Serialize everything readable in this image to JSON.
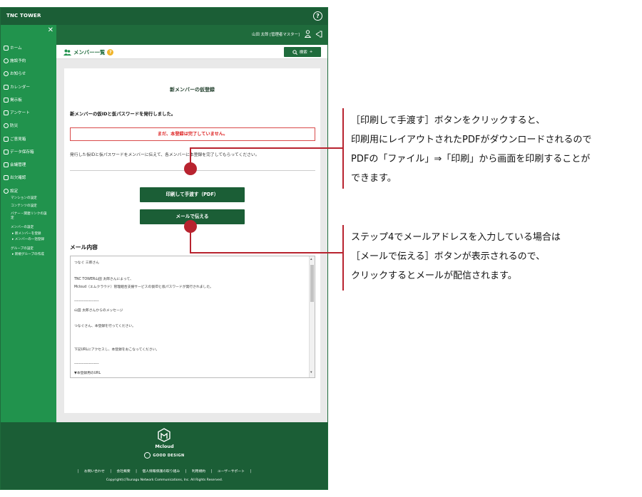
{
  "app": {
    "brand": "TNC TOWER",
    "help": "?"
  },
  "sidebar": {
    "close": "✕",
    "items": [
      {
        "label": "ホーム"
      },
      {
        "label": "施設予約"
      },
      {
        "label": "お知らせ"
      },
      {
        "label": "カレンダー"
      },
      {
        "label": "掲示板"
      },
      {
        "label": "アンケート"
      },
      {
        "label": "防災"
      },
      {
        "label": "ご意見箱"
      },
      {
        "label": "データ保存箱"
      },
      {
        "label": "会議管理"
      },
      {
        "label": "出欠確認"
      },
      {
        "label": "設定"
      }
    ],
    "settings_sub": [
      "マンションの設定",
      "コンテンツの設定",
      "バナー・関連リンクの設",
      "定",
      "メンバーの設定",
      "▸ 新メンバーを登録",
      "▸ メンバーの一括登録",
      "グループの設定",
      "▸ 新規グループの作成"
    ]
  },
  "userbar": {
    "name": "山田 太郎 [管理者マスター]"
  },
  "header": {
    "title": "メンバー一覧",
    "badge": "?",
    "search_label": "検索",
    "search_plus": "+"
  },
  "panel": {
    "title": "新メンバーの仮登録",
    "issued": "新メンバーの仮IDと仮パスワードを発行しました。",
    "warning": "まだ、本登録は完了していません。",
    "description": "発行した仮IDと仮パスワードをメンバーに伝えて、各メンバーに本登録を完了してもらってください。",
    "print_button": "印刷して手渡す（PDF）",
    "mail_button": "メールで伝える",
    "mail_heading": "メール内容",
    "mail_lines": [
      "つなぐ 三郎さん",
      "",
      "TNC TOWER山田 太郎さんによって、",
      "Mcloud（エムクラウド）管理組合支援サービスの仮IDと仮パスワードが発行されました。",
      "",
      "--------------------",
      "山田 太郎さんからのメッセージ",
      "",
      "つなぐさん、本登録を行ってください。",
      "",
      "",
      "下記URLにアクセスし、本登録をおこなってください。",
      "",
      "--------------------",
      "▼本登録用のURL"
    ]
  },
  "footer": {
    "logo_text": "Mcloud",
    "good_design": "GOOD DESIGN",
    "links": [
      "お問い合わせ",
      "会社概要",
      "個人情報保護の取り組み",
      "利用規約",
      "ユーザーサポート"
    ],
    "separator": "|",
    "copyright": "Copyright(c)Tsunagu Network Communications, Inc. All Rights Reserved."
  },
  "callouts": {
    "print": [
      "［印刷して手渡す］ボタンをクリックすると、",
      "印刷用にレイアウトされたPDFがダウンロードされるので",
      "PDFの「ファイル」⇒「印刷」から画面を印刷することが",
      "できます。"
    ],
    "mail": [
      "ステップ4でメールアドレスを入力している場合は",
      "［メールで伝える］ボタンが表示されるので、",
      "クリックするとメールが配信されます。"
    ]
  },
  "colors": {
    "header_green": "#1b5e36",
    "sidebar_green": "#21934d",
    "accent_red": "#b8232f",
    "warning_red": "#d22222"
  }
}
